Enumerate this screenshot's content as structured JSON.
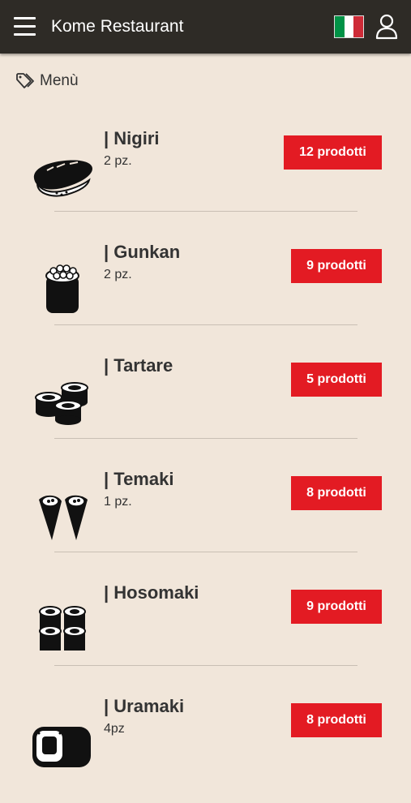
{
  "header": {
    "title": "Kome Restaurant",
    "menu_icon": "hamburger-menu-icon",
    "language_flag": "italy-flag-icon",
    "account_icon": "user-icon",
    "flag_colors": [
      "#009246",
      "#ffffff",
      "#ce2b37"
    ]
  },
  "breadcrumb": {
    "icon": "tag-icon",
    "label": "Menù"
  },
  "categories": [
    {
      "name": "| Nigiri",
      "subtitle": "2 pz.",
      "count": "12 prodotti",
      "icon": "nigiri-icon"
    },
    {
      "name": "| Gunkan",
      "subtitle": "2 pz.",
      "count": "9 prodotti",
      "icon": "gunkan-icon"
    },
    {
      "name": "| Tartare",
      "subtitle": "",
      "count": "5 prodotti",
      "icon": "tartare-icon"
    },
    {
      "name": "| Temaki",
      "subtitle": "1 pz.",
      "count": "8 prodotti",
      "icon": "temaki-icon"
    },
    {
      "name": "| Hosomaki",
      "subtitle": "",
      "count": "9 prodotti",
      "icon": "hosomaki-icon"
    },
    {
      "name": "| Uramaki",
      "subtitle": "4pz",
      "count": "8 prodotti",
      "icon": "uramaki-icon"
    }
  ],
  "colors": {
    "topbar": "#2e2b26",
    "background": "#f1e6da",
    "accent": "#e31b23"
  }
}
